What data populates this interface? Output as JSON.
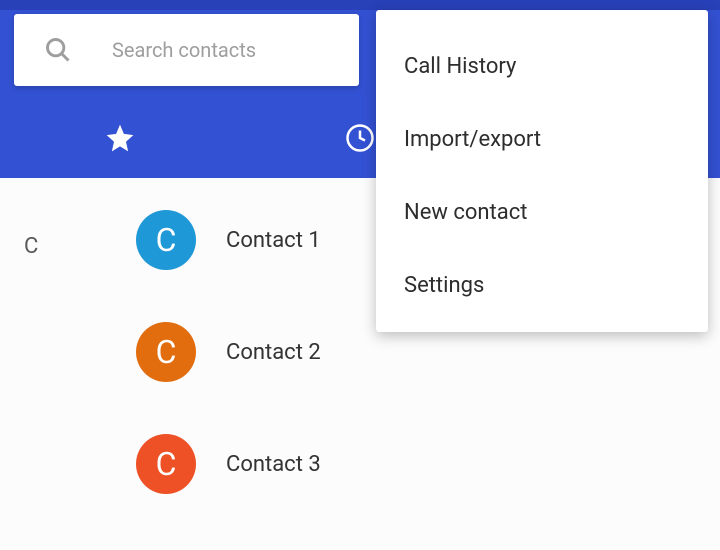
{
  "search": {
    "placeholder": "Search contacts"
  },
  "menu": {
    "items": [
      {
        "label": "Call History"
      },
      {
        "label": "Import/export"
      },
      {
        "label": "New contact"
      },
      {
        "label": "Settings"
      }
    ]
  },
  "section_letter": "C",
  "contacts": [
    {
      "initial": "C",
      "name": "Contact 1",
      "color": "#1e98d6"
    },
    {
      "initial": "C",
      "name": "Contact 2",
      "color": "#e16d0f"
    },
    {
      "initial": "C",
      "name": "Contact 3",
      "color": "#ed5125"
    }
  ]
}
